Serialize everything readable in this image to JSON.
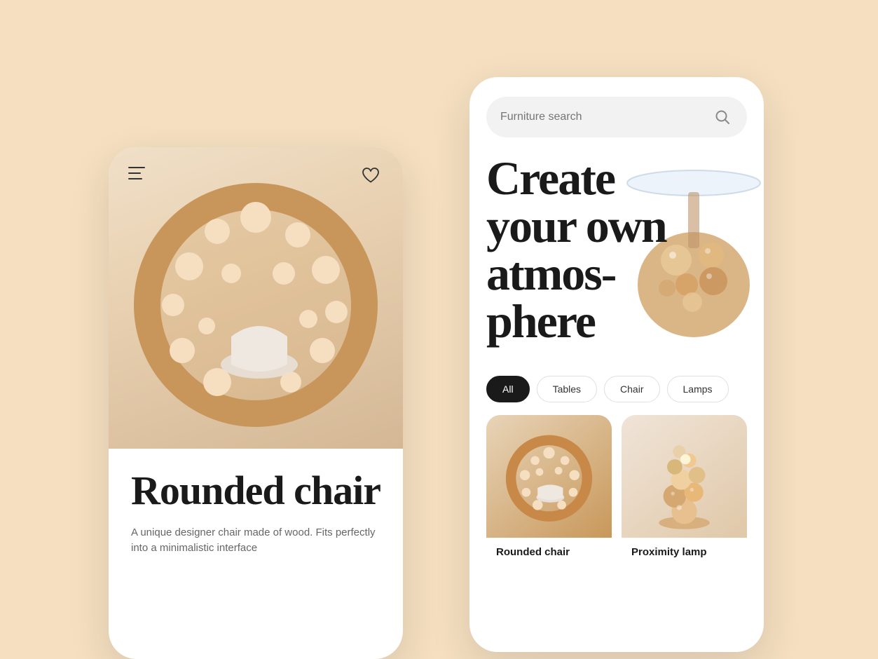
{
  "background_color": "#f5dfc0",
  "left_phone": {
    "menu_icon_label": "menu",
    "heart_icon_label": "favorite",
    "product_title": "Rounded chair",
    "product_description": "A unique designer chair made of wood. Fits perfectly into a minimalistic interface"
  },
  "right_phone": {
    "search_placeholder": "Furniture search",
    "search_icon": "search",
    "hero_text": "Create your own atmos-phere",
    "filters": [
      {
        "label": "All",
        "active": true
      },
      {
        "label": "Tables",
        "active": false
      },
      {
        "label": "Chair",
        "active": false
      },
      {
        "label": "Lamps",
        "active": false
      }
    ],
    "products": [
      {
        "name": "Rounded chair",
        "bg": "#e8d8c4"
      },
      {
        "name": "Proximity lamp",
        "bg": "#f0e4d8"
      }
    ]
  }
}
